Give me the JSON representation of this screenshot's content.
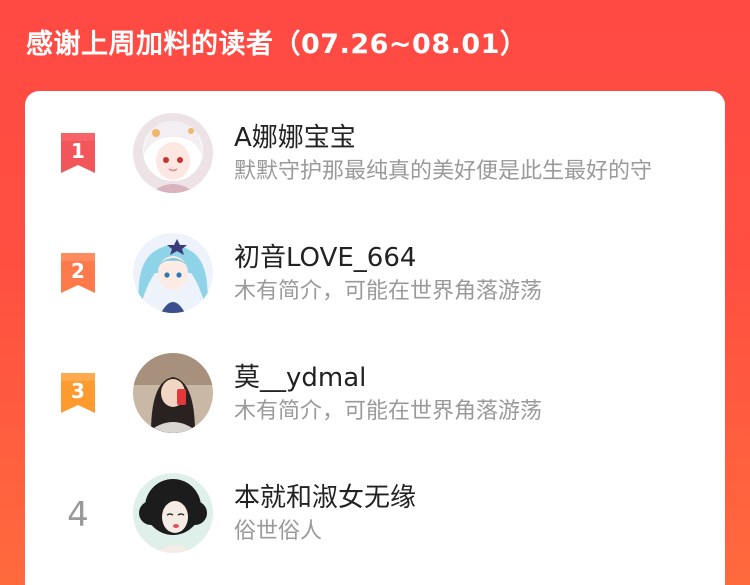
{
  "header": {
    "title": "感谢上周加料的读者（07.26~08.01）",
    "background_color": "#ff4a44"
  },
  "readers": [
    {
      "rank": "1",
      "name": "A娜娜宝宝",
      "bio": "默默守护那最纯真的美好便是此生最好的守",
      "badge_color": "#f2565a",
      "avatar_icon": "anime-girl-white-hair-avatar"
    },
    {
      "rank": "2",
      "name": "初音LOVE_664",
      "bio": "木有简介，可能在世界角落游荡",
      "badge_color": "#ff7a4a",
      "avatar_icon": "anime-girl-blue-twintails-avatar"
    },
    {
      "rank": "3",
      "name": "莫__ydmal",
      "bio": "木有简介，可能在世界角落游荡",
      "badge_color": "#ff9a2e",
      "avatar_icon": "selfie-girl-avatar"
    },
    {
      "rank": "4",
      "name": "本就和淑女无缘",
      "bio": "俗世俗人",
      "avatar_icon": "illustrated-girl-curly-hair-avatar"
    }
  ]
}
